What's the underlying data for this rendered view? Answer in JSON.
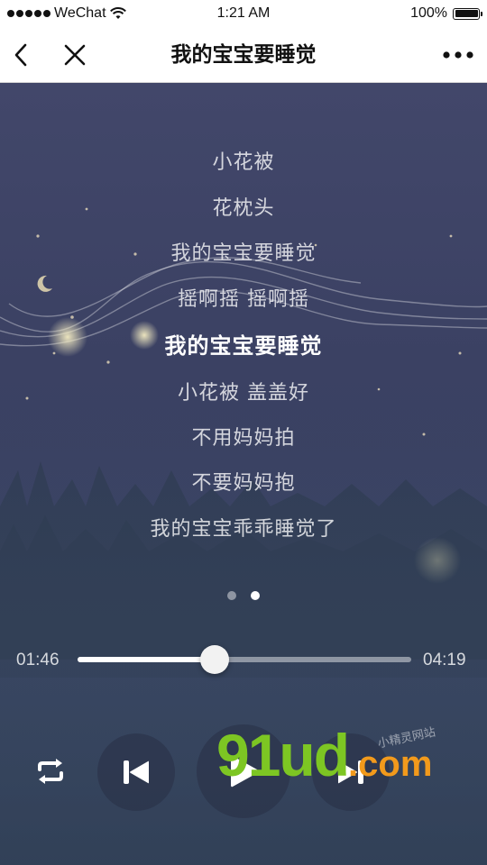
{
  "status_bar": {
    "carrier": "WeChat",
    "time": "1:21 AM",
    "battery": "100%"
  },
  "nav": {
    "title": "我的宝宝要睡觉",
    "back_icon": "chevron-left-icon",
    "close_icon": "close-icon",
    "more_icon": "more-horizontal-icon"
  },
  "lyrics": {
    "lines": [
      "小花被",
      "花枕头",
      "我的宝宝要睡觉",
      "摇啊摇  摇啊摇",
      "我的宝宝要睡觉",
      "小花被  盖盖好",
      "不用妈妈拍",
      "不要妈妈抱",
      "我的宝宝乖乖睡觉了"
    ],
    "active_index": 4
  },
  "pager": {
    "count": 2,
    "active_index": 1
  },
  "playback": {
    "current_time": "01:46",
    "total_time": "04:19",
    "progress": 0.41
  },
  "controls": {
    "repeat_icon": "repeat-icon",
    "prev_icon": "skip-previous-icon",
    "play_icon": "play-icon",
    "next_icon": "skip-next-icon"
  },
  "watermark": {
    "brand": "91ud",
    "domain": ".com",
    "tagline": "小精灵网站"
  },
  "colors": {
    "background": "#3a3f5e",
    "watermark_green": "#7dc623",
    "watermark_orange": "#f29a1c"
  }
}
